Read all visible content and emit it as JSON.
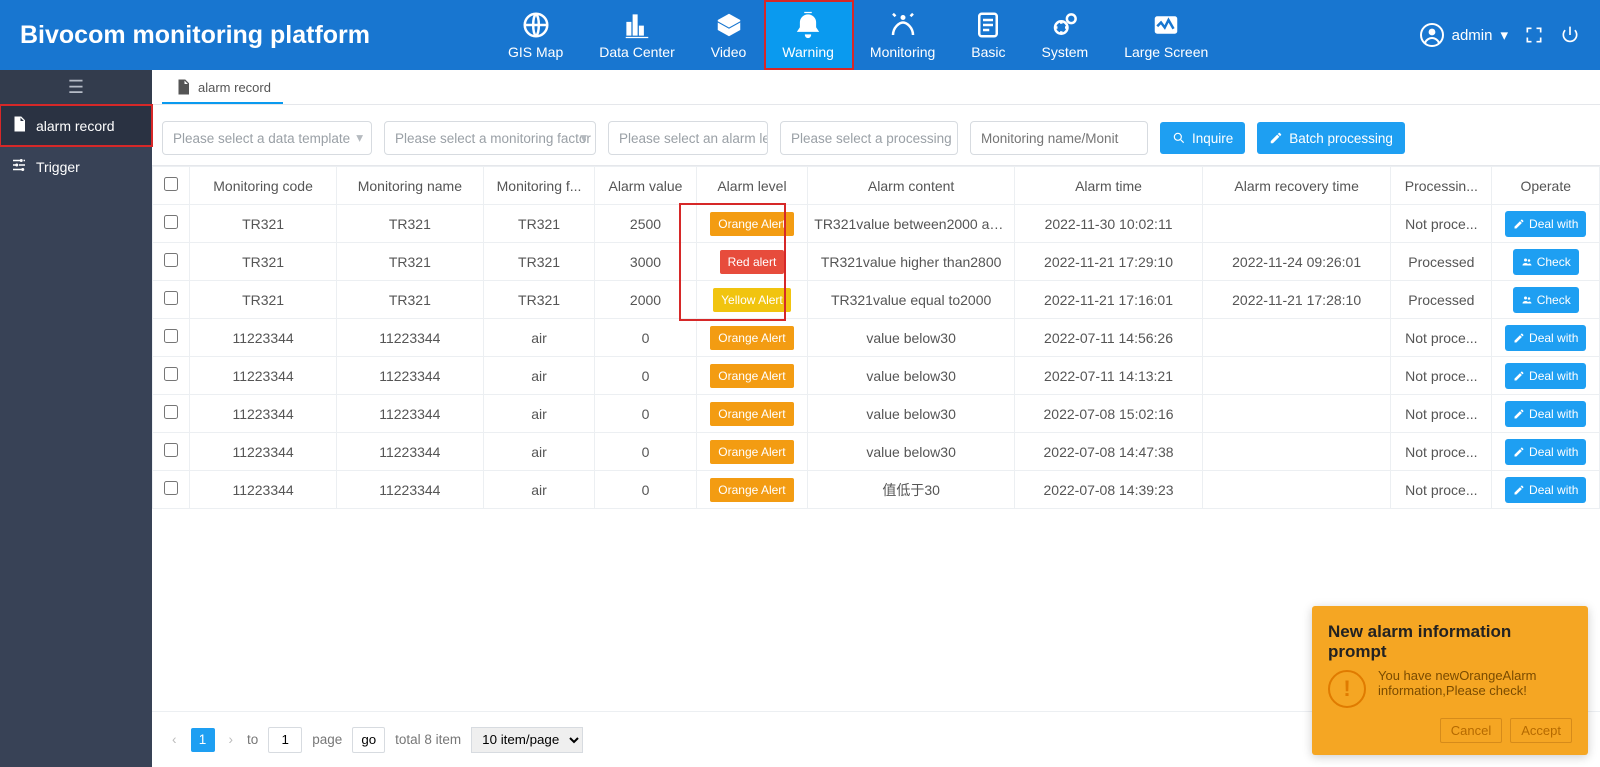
{
  "brand": "Bivocom monitoring platform",
  "nav": [
    {
      "label": "GIS Map"
    },
    {
      "label": "Data Center"
    },
    {
      "label": "Video"
    },
    {
      "label": "Warning",
      "active": true,
      "highlight": true
    },
    {
      "label": "Monitoring"
    },
    {
      "label": "Basic"
    },
    {
      "label": "System"
    },
    {
      "label": "Large Screen"
    }
  ],
  "user": {
    "name": "admin"
  },
  "sidebar": {
    "items": [
      {
        "label": "alarm record",
        "active": true,
        "icon": "doc-icon"
      },
      {
        "label": "Trigger",
        "icon": "sliders-icon"
      }
    ]
  },
  "tab": {
    "label": "alarm record"
  },
  "filters": {
    "template": "Please select a data template",
    "factor": "Please select a monitoring factor",
    "level": "Please select an alarm leve",
    "processing": "Please select a processing",
    "search_placeholder": "Monitoring name/Monitoring",
    "inquire": "Inquire",
    "batch": "Batch processing"
  },
  "table": {
    "headers": {
      "code": "Monitoring code",
      "name": "Monitoring name",
      "factor": "Monitoring f...",
      "value": "Alarm value",
      "level": "Alarm level",
      "content": "Alarm content",
      "time": "Alarm time",
      "recover": "Alarm recovery time",
      "proc": "Processin...",
      "op": "Operate"
    },
    "rows": [
      {
        "code": "TR321",
        "name": "TR321",
        "factor": "TR321",
        "value": "2500",
        "level": "Orange Alert",
        "level_class": "alert-orange",
        "content": "TR321value between2000 an...",
        "time": "2022-11-30 10:02:11",
        "recover": "",
        "proc": "Not proce...",
        "op": "Deal with",
        "op_icon": "edit"
      },
      {
        "code": "TR321",
        "name": "TR321",
        "factor": "TR321",
        "value": "3000",
        "level": "Red alert",
        "level_class": "alert-red",
        "content": "TR321value higher than2800",
        "time": "2022-11-21 17:29:10",
        "recover": "2022-11-24 09:26:01",
        "proc": "Processed",
        "op": "Check",
        "op_icon": "users"
      },
      {
        "code": "TR321",
        "name": "TR321",
        "factor": "TR321",
        "value": "2000",
        "level": "Yellow Alert",
        "level_class": "alert-yellow",
        "content": "TR321value equal to2000",
        "time": "2022-11-21 17:16:01",
        "recover": "2022-11-21 17:28:10",
        "proc": "Processed",
        "op": "Check",
        "op_icon": "users"
      },
      {
        "code": "11223344",
        "name": "11223344",
        "factor": "air",
        "value": "0",
        "level": "Orange Alert",
        "level_class": "alert-orange",
        "content": "value below30",
        "time": "2022-07-11 14:56:26",
        "recover": "",
        "proc": "Not proce...",
        "op": "Deal with",
        "op_icon": "edit"
      },
      {
        "code": "11223344",
        "name": "11223344",
        "factor": "air",
        "value": "0",
        "level": "Orange Alert",
        "level_class": "alert-orange",
        "content": "value below30",
        "time": "2022-07-11 14:13:21",
        "recover": "",
        "proc": "Not proce...",
        "op": "Deal with",
        "op_icon": "edit"
      },
      {
        "code": "11223344",
        "name": "11223344",
        "factor": "air",
        "value": "0",
        "level": "Orange Alert",
        "level_class": "alert-orange",
        "content": "value below30",
        "time": "2022-07-08 15:02:16",
        "recover": "",
        "proc": "Not proce...",
        "op": "Deal with",
        "op_icon": "edit"
      },
      {
        "code": "11223344",
        "name": "11223344",
        "factor": "air",
        "value": "0",
        "level": "Orange Alert",
        "level_class": "alert-orange",
        "content": "value below30",
        "time": "2022-07-08 14:47:38",
        "recover": "",
        "proc": "Not proce...",
        "op": "Deal with",
        "op_icon": "edit"
      },
      {
        "code": "11223344",
        "name": "11223344",
        "factor": "air",
        "value": "0",
        "level": "Orange Alert",
        "level_class": "alert-orange",
        "content": "值低于30",
        "time": "2022-07-08 14:39:23",
        "recover": "",
        "proc": "Not proce...",
        "op": "Deal with",
        "op_icon": "edit"
      }
    ]
  },
  "pager": {
    "page": "1",
    "to": "to",
    "jump": "1",
    "page_label": "page",
    "go": "go",
    "total": "total 8 item",
    "per": "10 item/page"
  },
  "toast": {
    "title": "New alarm information prompt",
    "msg": "You have newOrangeAlarm information,Please check!",
    "cancel": "Cancel",
    "accept": "Accept"
  }
}
